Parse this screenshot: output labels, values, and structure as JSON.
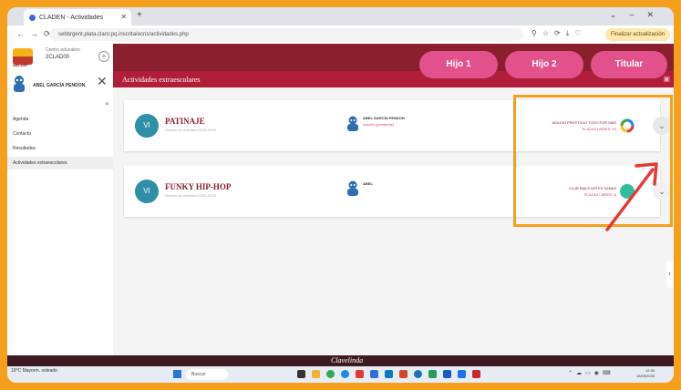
{
  "browser": {
    "tab_title": "CLADEN - Actividades",
    "url": "sebbrgent.plata.claro.pq.inscrita/ecris/actividades.php",
    "update_label": "Finalizar actualización"
  },
  "sidebar": {
    "logo_label": "ABCDEF",
    "school_line1": "Centro educativo",
    "school_line2": "2CLAD00",
    "user_name": "ABEL GARCÍA PENDON",
    "items": [
      {
        "label": "Agenda"
      },
      {
        "label": "Contacto"
      },
      {
        "label": "Resultados"
      },
      {
        "label": "Actividades extraescolares"
      }
    ]
  },
  "header": {
    "section_title": "Actividades extraescolares",
    "profile_buttons": [
      "Hijo 1",
      "Hijo 2",
      "Titular"
    ]
  },
  "activities": [
    {
      "badge": "VI",
      "title": "PATINAJE",
      "subtitle": "Horario de actividad 2025-2026",
      "kid_name": "ABEL GARCÍA PENDON",
      "kid_status": "Inscrito (pendiente)",
      "school_line1": "ADAGIO PRESTIGIO TODO POR MAS",
      "school_line2": "PLAZAS LIBRES: 10",
      "ring_colors": [
        "#e53935",
        "#fbc02d",
        "#43a047",
        "#1e88e5"
      ]
    },
    {
      "badge": "VI",
      "title": "FUNKY HIP-HOP",
      "subtitle": "Horario de actividad 2025-2026",
      "kid_name": "ABEL",
      "kid_status": "",
      "school_line1": "CLUB BAILE ARTES SANAS",
      "school_line2": "PLAZAS LIBRES: 8",
      "ring_colors": [
        "#2fbfa0",
        "#2fbfa0",
        "#2fbfa0",
        "#2fbfa0"
      ]
    }
  ],
  "footer": {
    "brand": "Clavelinda"
  },
  "taskbar": {
    "weather_temp": "19°C",
    "weather_desc": "Mayorm. soleado",
    "search_placeholder": "Buscar",
    "time": "12:30",
    "date": "15/09/2025"
  },
  "colors": {
    "maroon": "#8a1f2d",
    "crimson": "#b01e3a",
    "pink": "#e2518c",
    "teal": "#2f8fa6",
    "highlight": "#f59f1f",
    "arrow": "#e53935"
  }
}
